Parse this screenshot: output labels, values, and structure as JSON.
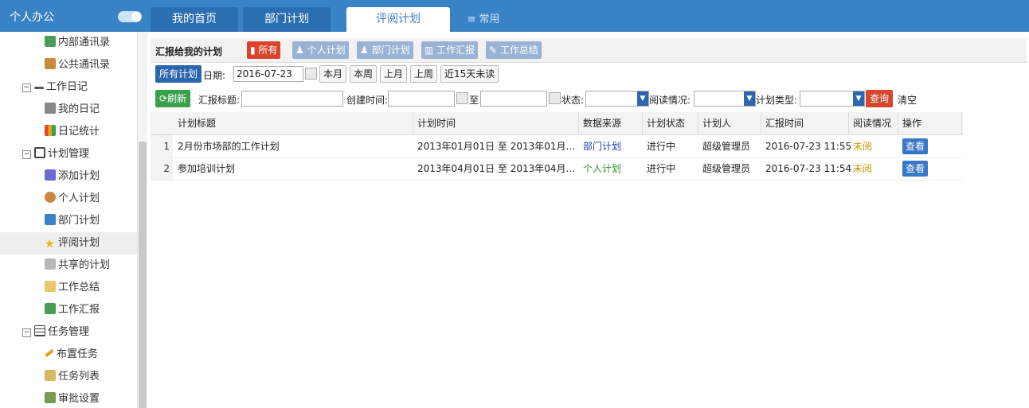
{
  "header": {
    "title": "个人办公"
  },
  "tabs": [
    {
      "label": "我的首页"
    },
    {
      "label": "部门计划"
    },
    {
      "label": "评阅计划"
    },
    {
      "label": "≡ 常用"
    }
  ],
  "sidebar": {
    "items": [
      {
        "label": "内部通讯录",
        "icon": "addressbook-icon",
        "level": 2
      },
      {
        "label": "公共通讯录",
        "icon": "public-contacts-icon",
        "level": 2
      },
      {
        "label": "工作日记",
        "icon": "pencil-icon",
        "level": 1
      },
      {
        "label": "我的日记",
        "icon": "diary-icon",
        "level": 2
      },
      {
        "label": "日记统计",
        "icon": "stats-icon",
        "level": 2
      },
      {
        "label": "计划管理",
        "icon": "edit-box-icon",
        "level": 1
      },
      {
        "label": "添加计划",
        "icon": "add-plan-icon",
        "level": 2
      },
      {
        "label": "个人计划",
        "icon": "person-icon",
        "level": 2
      },
      {
        "label": "部门计划",
        "icon": "org-icon",
        "level": 2
      },
      {
        "label": "评阅计划",
        "icon": "star-icon",
        "level": 2,
        "selected": true
      },
      {
        "label": "共享的计划",
        "icon": "share-icon",
        "level": 2
      },
      {
        "label": "工作总结",
        "icon": "summary-icon",
        "level": 2
      },
      {
        "label": "工作汇报",
        "icon": "report-icon",
        "level": 2
      },
      {
        "label": "任务管理",
        "icon": "list-icon",
        "level": 1
      },
      {
        "label": "布置任务",
        "icon": "pen-icon",
        "level": 2
      },
      {
        "label": "任务列表",
        "icon": "task-list-icon",
        "level": 2
      },
      {
        "label": "审批设置",
        "icon": "approve-icon",
        "level": 2
      }
    ]
  },
  "toolbar": {
    "title": "汇报给我的计划",
    "all": "所有",
    "personal": "个人计划",
    "dept": "部门计划",
    "report": "工作汇报",
    "summary": "工作总结"
  },
  "datebar": {
    "all_plans": "所有计划",
    "date_label": "日期:",
    "date_value": "2016-07-23",
    "this_month": "本月",
    "this_week": "本周",
    "last_month": "上月",
    "last_week": "上周",
    "unread15": "近15天未读"
  },
  "filter": {
    "refresh": "刷新",
    "title_label": "汇报标题:",
    "created_label": "创建时间:",
    "to": "至",
    "status_label": "状态:",
    "read_label": "阅读情况:",
    "type_label": "计划类型:",
    "query": "查询",
    "clear": "清空"
  },
  "table": {
    "columns": [
      "计划标题",
      "计划时间",
      "数据来源",
      "计划状态",
      "计划人",
      "汇报时间",
      "阅读情况",
      "操作"
    ],
    "rows": [
      {
        "n": "1",
        "title": "2月份市场部的工作计划",
        "time": "2013年01月01日 至 2013年01月...",
        "source": "部门计划",
        "status": "进行中",
        "person": "超级管理员",
        "reported": "2016-07-23 11:55",
        "read": "未阅",
        "op": "查看"
      },
      {
        "n": "2",
        "title": "参加培训计划",
        "time": "2013年04月01日 至 2013年04月...",
        "source": "个人计划",
        "status": "进行中",
        "person": "超级管理员",
        "reported": "2016-07-23 11:54",
        "read": "未阅",
        "op": "查看"
      }
    ]
  },
  "colors": {
    "primary": "#3a82c6",
    "danger": "#d9442d",
    "green": "#3aa24a",
    "unread": "#c79a00",
    "source_dept": "#1e3ea8",
    "source_personal": "#2a9a2a"
  }
}
